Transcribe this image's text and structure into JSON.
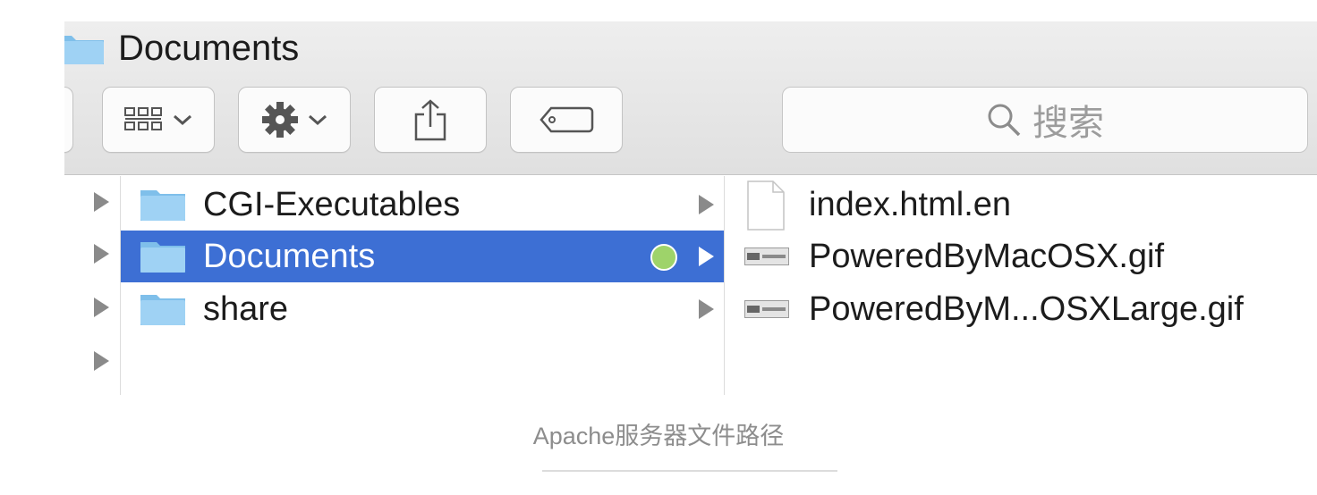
{
  "window": {
    "title": "Documents"
  },
  "toolbar": {
    "buttons": [
      {
        "name": "view-options-button",
        "icon": "grid-icon",
        "has_chevron": true
      },
      {
        "name": "action-button",
        "icon": "gear-icon",
        "has_chevron": true
      },
      {
        "name": "share-button",
        "icon": "share-icon"
      },
      {
        "name": "tags-button",
        "icon": "tag-icon"
      }
    ],
    "search": {
      "icon": "search-icon",
      "placeholder": "搜索"
    }
  },
  "columns": {
    "folders": [
      {
        "label": "CGI-Executables",
        "selected": false
      },
      {
        "label": "Documents",
        "selected": true,
        "tag_color": "#9ed36a"
      },
      {
        "label": "share",
        "selected": false
      }
    ],
    "files": [
      {
        "label": "index.html.en",
        "icon": "document-icon"
      },
      {
        "label": "PoweredByMacOSX.gif",
        "icon": "gif-thumbnail-icon"
      },
      {
        "label": "PoweredByM...OSXLarge.gif",
        "icon": "gif-thumbnail-icon"
      }
    ]
  },
  "colors": {
    "selection": "#3d6fd4",
    "folder": "#86c3ed",
    "tag": "#9ed36a"
  },
  "caption": "Apache服务器文件路径"
}
